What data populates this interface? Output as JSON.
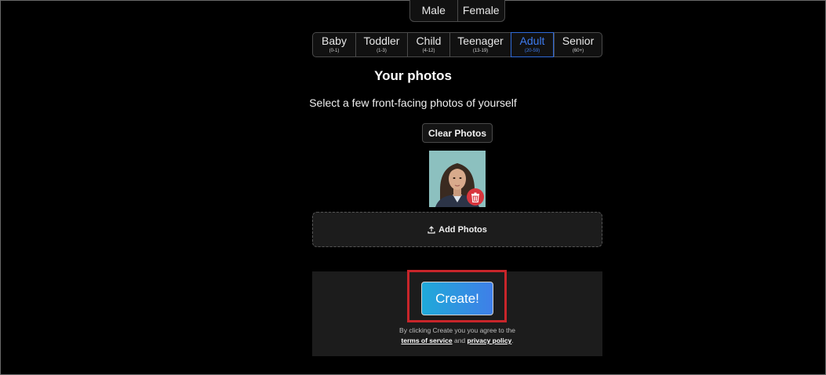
{
  "gender": {
    "options": [
      "Male",
      "Female"
    ]
  },
  "age": {
    "options": [
      {
        "label": "Baby",
        "range": "(0-1)"
      },
      {
        "label": "Toddler",
        "range": "(1-3)"
      },
      {
        "label": "Child",
        "range": "(4-12)"
      },
      {
        "label": "Teenager",
        "range": "(13-19)"
      },
      {
        "label": "Adult",
        "range": "(20-59)"
      },
      {
        "label": "Senior",
        "range": "(60+)"
      }
    ],
    "selected": "Adult"
  },
  "photos": {
    "title": "Your photos",
    "subtitle": "Select a few front-facing photos of yourself",
    "clear_label": "Clear Photos",
    "add_label": "Add Photos",
    "upload_icon": "upload-icon",
    "delete_icon": "trash-icon"
  },
  "create": {
    "button_label": "Create!",
    "terms_prefix": "By clicking Create you you agree to the",
    "terms_link": "terms of service",
    "and": "and",
    "privacy_link": "privacy policy",
    "period": "."
  },
  "colors": {
    "accent": "#3d7bf0",
    "highlight": "#c8252a",
    "delete": "#d9363e"
  }
}
